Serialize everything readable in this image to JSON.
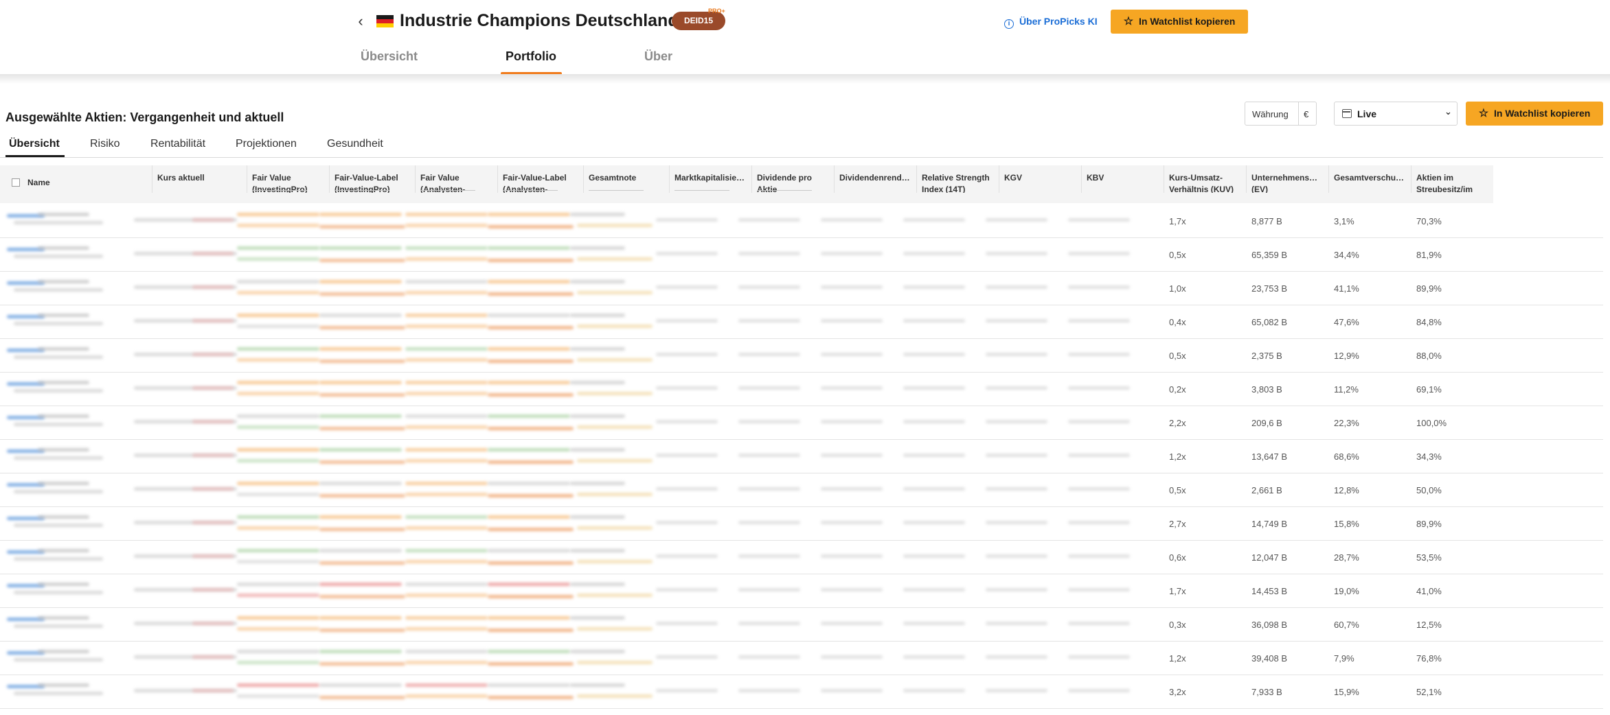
{
  "header": {
    "back_label": "‹",
    "title": "Industrie Champions Deutschland",
    "code": "DEID15",
    "pro_mark": "PRO+",
    "info_link": "Über ProPicks KI",
    "watchlist_button": "In Watchlist kopieren",
    "tabs": [
      {
        "label": "Übersicht",
        "active": false
      },
      {
        "label": "Portfolio",
        "active": true
      },
      {
        "label": "Über",
        "active": false
      }
    ]
  },
  "section": {
    "title": "Ausgewählte Aktien: Vergangenheit und aktuell",
    "currency_label": "Währung",
    "currency_value": "€",
    "period_value": "Live",
    "watchlist_button": "In Watchlist kopieren",
    "tabs": [
      {
        "label": "Übersicht",
        "active": true
      },
      {
        "label": "Risiko",
        "active": false
      },
      {
        "label": "Rentabilität",
        "active": false
      },
      {
        "label": "Projektionen",
        "active": false
      },
      {
        "label": "Gesundheit",
        "active": false
      }
    ]
  },
  "table": {
    "columns": [
      "Name",
      "Kurs aktuell",
      "Fair Value (InvestingPro)",
      "Fair-Value-Label (InvestingPro)",
      "Fair Value (Analysten-",
      "Fair-Value-Label (Analysten-",
      "Gesamtnote",
      "Marktkapitalisie…",
      "Dividende pro Aktie",
      "Dividendenrend…",
      "Relative Strength Index (14T)",
      "KGV",
      "KBV",
      "Kurs-Umsatz-Verhältnis (KUV)",
      "Unternehmens… (EV)",
      "Gesamtverschu…",
      "Aktien im Streubesitz/im"
    ],
    "rows": [
      {
        "kuv": "1,7x",
        "ev": "8,877 B",
        "debt": "3,1%",
        "float": "70,3%"
      },
      {
        "kuv": "0,5x",
        "ev": "65,359 B",
        "debt": "34,4%",
        "float": "81,9%"
      },
      {
        "kuv": "1,0x",
        "ev": "23,753 B",
        "debt": "41,1%",
        "float": "89,9%"
      },
      {
        "kuv": "0,4x",
        "ev": "65,082 B",
        "debt": "47,6%",
        "float": "84,8%"
      },
      {
        "kuv": "0,5x",
        "ev": "2,375 B",
        "debt": "12,9%",
        "float": "88,0%"
      },
      {
        "kuv": "0,2x",
        "ev": "3,803 B",
        "debt": "11,2%",
        "float": "69,1%"
      },
      {
        "kuv": "2,2x",
        "ev": "209,6 B",
        "debt": "22,3%",
        "float": "100,0%"
      },
      {
        "kuv": "1,2x",
        "ev": "13,647 B",
        "debt": "68,6%",
        "float": "34,3%"
      },
      {
        "kuv": "0,5x",
        "ev": "2,661 B",
        "debt": "12,8%",
        "float": "50,0%"
      },
      {
        "kuv": "2,7x",
        "ev": "14,749 B",
        "debt": "15,8%",
        "float": "89,9%"
      },
      {
        "kuv": "0,6x",
        "ev": "12,047 B",
        "debt": "28,7%",
        "float": "53,5%"
      },
      {
        "kuv": "1,7x",
        "ev": "14,453 B",
        "debt": "19,0%",
        "float": "41,0%"
      },
      {
        "kuv": "0,3x",
        "ev": "36,098 B",
        "debt": "60,7%",
        "float": "12,5%"
      },
      {
        "kuv": "1,2x",
        "ev": "39,408 B",
        "debt": "7,9%",
        "float": "76,8%"
      },
      {
        "kuv": "3,2x",
        "ev": "7,933 B",
        "debt": "15,9%",
        "float": "52,1%"
      }
    ]
  },
  "colors": {
    "accent_orange": "#f6a623",
    "tab_underline": "#f07a1a",
    "badge_brown": "#9a4a2a",
    "link_blue": "#1a6dd6"
  }
}
